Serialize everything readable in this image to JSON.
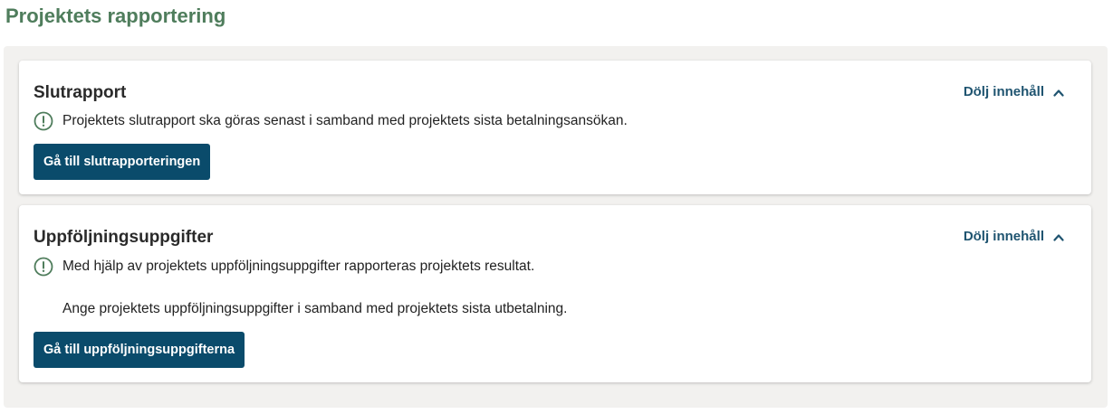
{
  "page": {
    "title": "Projektets rapportering"
  },
  "colors": {
    "title_green": "#4f7d5c",
    "button_blue": "#0a4b6b",
    "link_blue": "#1f5470",
    "panel_bg": "#f2f1ef"
  },
  "sections": [
    {
      "title": "Slutrapport",
      "toggle_label": "Dölj innehåll",
      "toggle_icon": "chevron-up-icon",
      "info_icon": "exclamation-circle-icon",
      "info_text": "Projektets slutrapport ska göras senast i samband med projektets sista betalningsansökan.",
      "button_label": "Gå till slutrapporteringen"
    },
    {
      "title": "Uppföljningsuppgifter",
      "toggle_label": "Dölj innehåll",
      "toggle_icon": "chevron-up-icon",
      "info_icon": "exclamation-circle-icon",
      "info_text": "Med hjälp av projektets uppföljningsuppgifter rapporteras projektets resultat.",
      "info_text_2": "Ange projektets uppföljningsuppgifter i samband med projektets sista utbetalning.",
      "button_label": "Gå till uppföljningsuppgifterna"
    }
  ]
}
